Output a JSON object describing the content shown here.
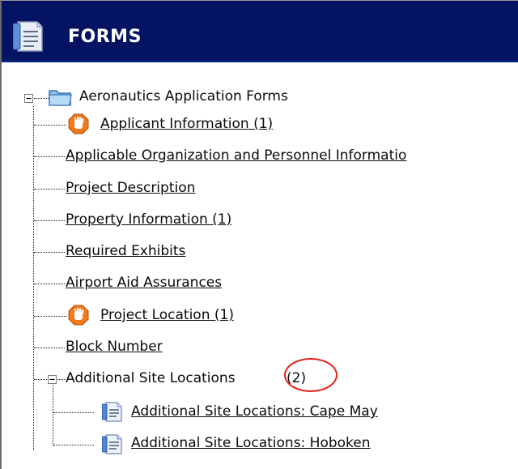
{
  "header": {
    "title": "FORMS",
    "icon": "forms-document-icon"
  },
  "tree": {
    "root": {
      "label": "Aeronautics Application Forms",
      "icon": "folder-icon",
      "expander": "collapse-minus-icon"
    },
    "items": [
      {
        "label": "Applicant Information (1)",
        "status_icon": "stop-hand-icon"
      },
      {
        "label": "Applicable Organization and Personnel Informatio"
      },
      {
        "label": "Project Description"
      },
      {
        "label": "Property Information (1)"
      },
      {
        "label": "Required Exhibits"
      },
      {
        "label": "Airport Aid Assurances"
      },
      {
        "label": "Project Location (1)",
        "status_icon": "stop-hand-icon"
      },
      {
        "label": "Block Number"
      }
    ],
    "group": {
      "label": "Additional Site Locations",
      "count": "(2)",
      "expander": "collapse-minus-icon",
      "children": [
        {
          "label": "Additional Site Locations: Cape May",
          "icon": "document-icon"
        },
        {
          "label": "Additional Site Locations: Hoboken",
          "icon": "document-icon"
        }
      ]
    }
  },
  "colors": {
    "header_bg": "#041463",
    "annotation_circle": "#e2231a",
    "stop_icon": "#f07a1e"
  }
}
